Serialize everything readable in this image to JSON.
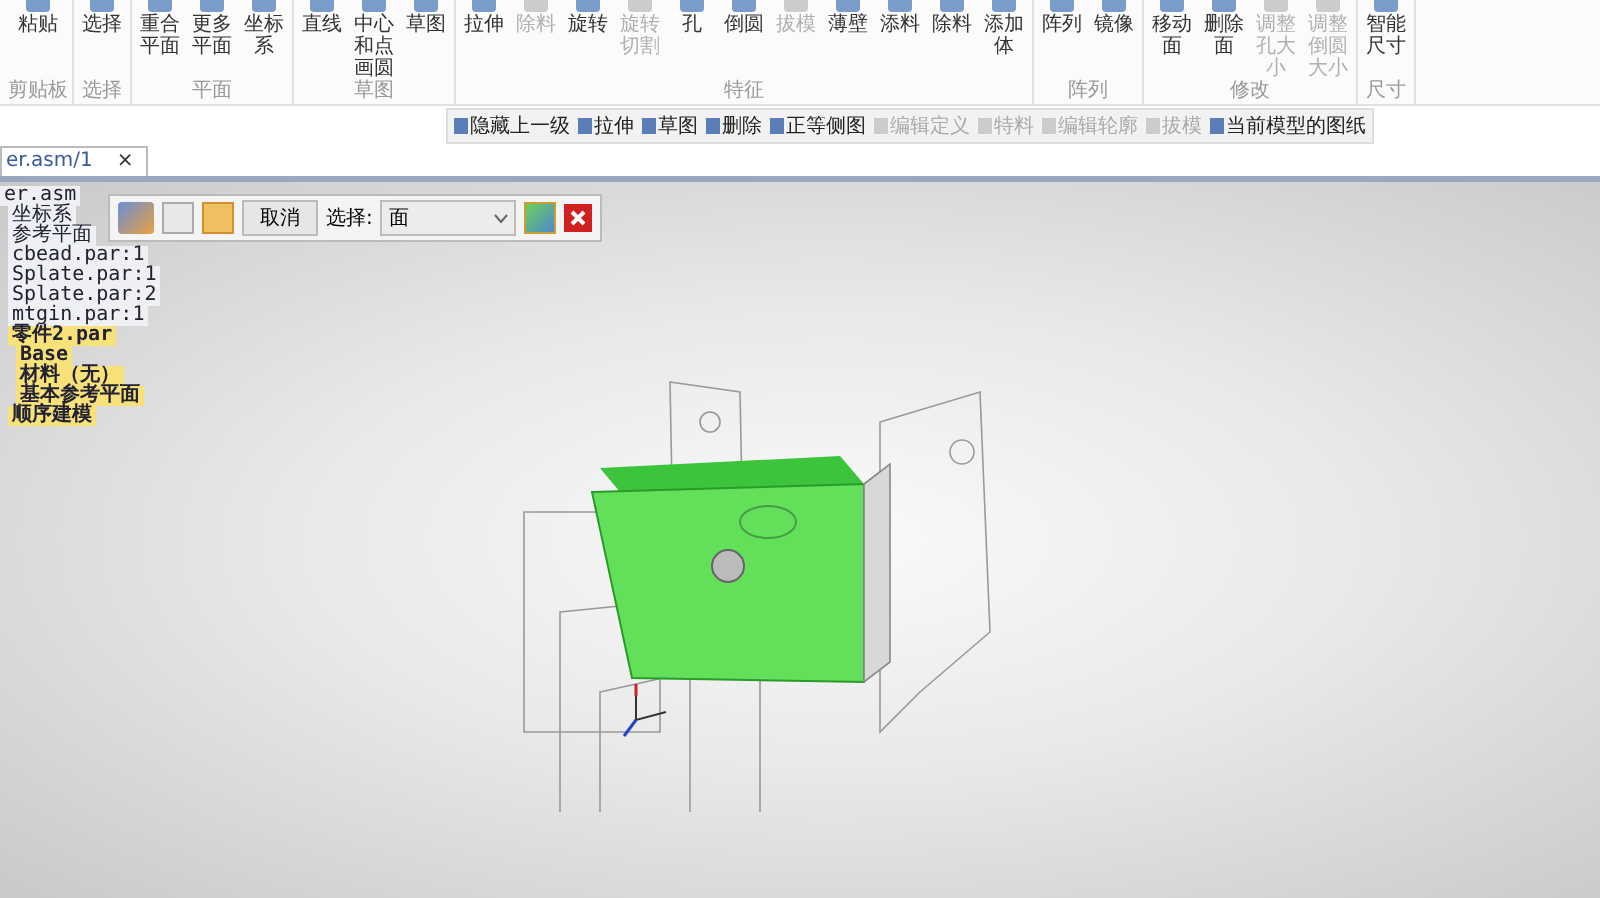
{
  "ribbon": {
    "groups": [
      {
        "label": "剪贴板",
        "tools": [
          {
            "label": "粘贴",
            "disabled": false
          }
        ]
      },
      {
        "label": "选择",
        "tools": [
          {
            "label": "选择",
            "disabled": false
          }
        ]
      },
      {
        "label": "平面",
        "tools": [
          {
            "label": "重合平面",
            "disabled": false
          },
          {
            "label": "更多平面",
            "disabled": false
          },
          {
            "label": "坐标系",
            "disabled": false
          }
        ]
      },
      {
        "label": "草图",
        "tools": [
          {
            "label": "直线",
            "disabled": false
          },
          {
            "label": "中心和点画圆",
            "disabled": false
          },
          {
            "label": "草图",
            "disabled": false
          }
        ]
      },
      {
        "label": "特征",
        "tools": [
          {
            "label": "拉伸",
            "disabled": false
          },
          {
            "label": "除料",
            "disabled": true
          },
          {
            "label": "旋转",
            "disabled": false
          },
          {
            "label": "旋转切割",
            "disabled": true
          },
          {
            "label": "孔",
            "disabled": false
          },
          {
            "label": "倒圆",
            "disabled": false
          },
          {
            "label": "拔模",
            "disabled": true
          },
          {
            "label": "薄壁",
            "disabled": false
          },
          {
            "label": "添料",
            "disabled": false
          },
          {
            "label": "除料",
            "disabled": false
          },
          {
            "label": "添加体",
            "disabled": false
          }
        ]
      },
      {
        "label": "阵列",
        "tools": [
          {
            "label": "阵列",
            "disabled": false
          },
          {
            "label": "镜像",
            "disabled": false
          }
        ]
      },
      {
        "label": "修改",
        "tools": [
          {
            "label": "移动面",
            "disabled": false
          },
          {
            "label": "删除面",
            "disabled": false
          },
          {
            "label": "调整孔大小",
            "disabled": true
          },
          {
            "label": "调整倒圆大小",
            "disabled": true
          }
        ]
      },
      {
        "label": "尺寸",
        "tools": [
          {
            "label": "智能尺寸",
            "disabled": false
          }
        ]
      }
    ]
  },
  "quick_toolbar": [
    {
      "label": "隐藏上一级",
      "disabled": false
    },
    {
      "label": "拉伸",
      "disabled": false
    },
    {
      "label": "草图",
      "disabled": false
    },
    {
      "label": "删除",
      "disabled": false
    },
    {
      "label": "正等侧图",
      "disabled": false
    },
    {
      "label": "编辑定义",
      "disabled": true
    },
    {
      "label": "特料",
      "disabled": true
    },
    {
      "label": "编辑轮廓",
      "disabled": true
    },
    {
      "label": "拔模",
      "disabled": true
    },
    {
      "label": "当前模型的图纸",
      "disabled": false
    }
  ],
  "document_tab": {
    "label": "er.asm/1",
    "close": "×"
  },
  "tree": [
    {
      "label": "er.asm",
      "selected": false,
      "children": [
        {
          "label": "坐标系",
          "selected": false
        },
        {
          "label": "参考平面",
          "selected": false
        },
        {
          "label": "cbead.par:1",
          "selected": false
        },
        {
          "label": "Splate.par:1",
          "selected": false
        },
        {
          "label": "Splate.par:2",
          "selected": false
        },
        {
          "label": "mtgin.par:1",
          "selected": false
        },
        {
          "label": "零件2.par",
          "selected": true,
          "children": [
            {
              "label": "Base",
              "selected": true
            },
            {
              "label": "材料（无）",
              "selected": true
            },
            {
              "label": "基本参考平面",
              "selected": true
            }
          ]
        },
        {
          "label": "顺序建模",
          "selected": true
        }
      ]
    }
  ],
  "command_bar": {
    "modes": [
      {
        "selected": false
      },
      {
        "selected": true
      }
    ],
    "cancel": "取消",
    "select_label": "选择:",
    "select_value": "面"
  }
}
